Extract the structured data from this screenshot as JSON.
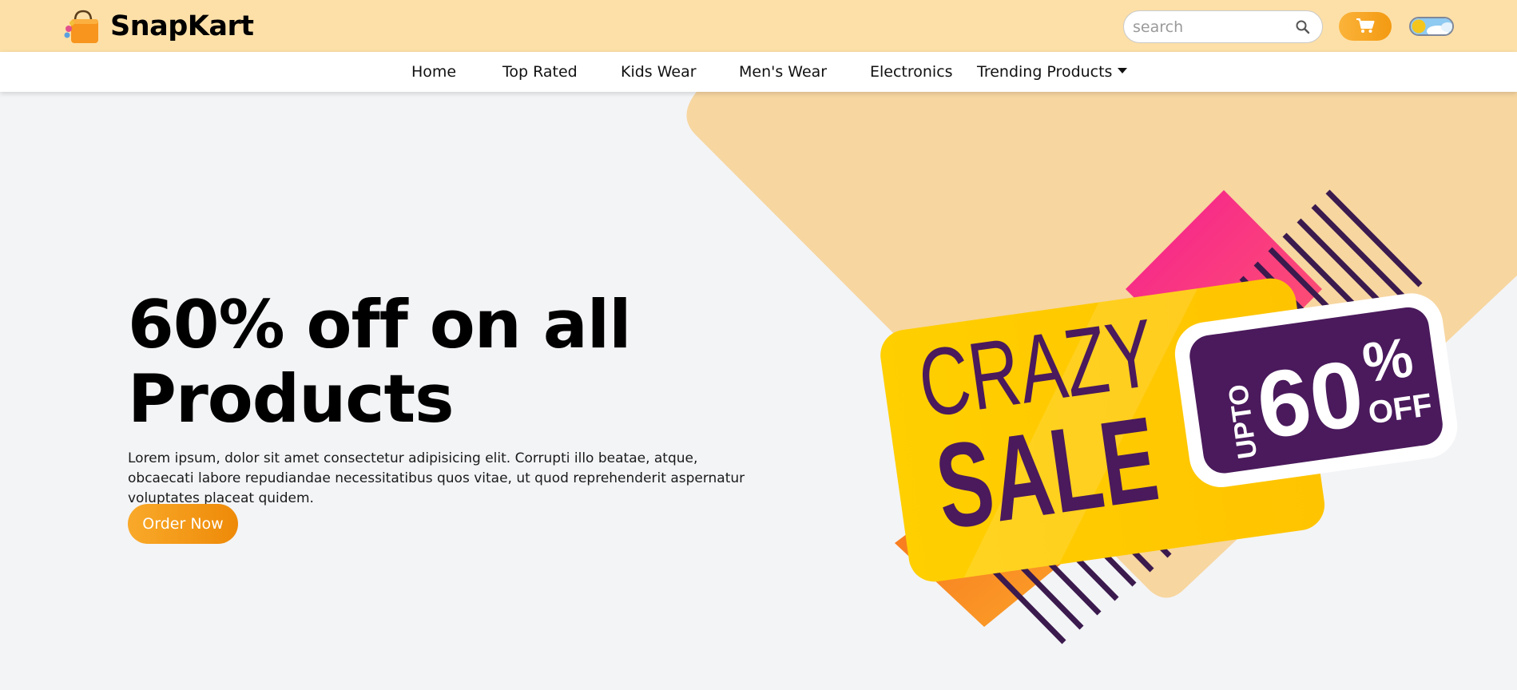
{
  "brand": {
    "name": "SnapKart",
    "logo_icon": "shopping-bag-icon"
  },
  "search": {
    "placeholder": "search",
    "value": "",
    "icon": "search-icon"
  },
  "cart": {
    "icon": "cart-icon"
  },
  "theme_toggle": {
    "icon": "sun-cloud-icon",
    "state": "light"
  },
  "nav": {
    "items": [
      {
        "label": "Home"
      },
      {
        "label": "Top Rated"
      },
      {
        "label": "Kids Wear"
      },
      {
        "label": "Men's Wear"
      },
      {
        "label": "Electronics"
      },
      {
        "label": "Trending Products",
        "icon": "caret-down-icon"
      }
    ]
  },
  "hero": {
    "title": "60% off on all Products",
    "description": "Lorem ipsum, dolor sit amet consectetur adipisicing elit. Corrupti illo beatae, atque, obcaecati labore repudiandae necessitatibus quos vitae, ut quod reprehenderit aspernatur voluptates placeat quidem.",
    "cta_label": "Order Now"
  },
  "banner": {
    "line1": "CRAZY",
    "line2": "SALE",
    "upto": "UPTO",
    "percent": "60",
    "percent_sign": "%",
    "off": "OFF"
  },
  "colors": {
    "topbar": "#fde0a8",
    "accent": "#f5a21c",
    "banner_yellow": "#ffcc00",
    "banner_purple": "#4a1a5c",
    "banner_pink": "#f02c8e",
    "banner_orange": "#f7861e",
    "backdrop_tan": "#f7d6a0"
  }
}
